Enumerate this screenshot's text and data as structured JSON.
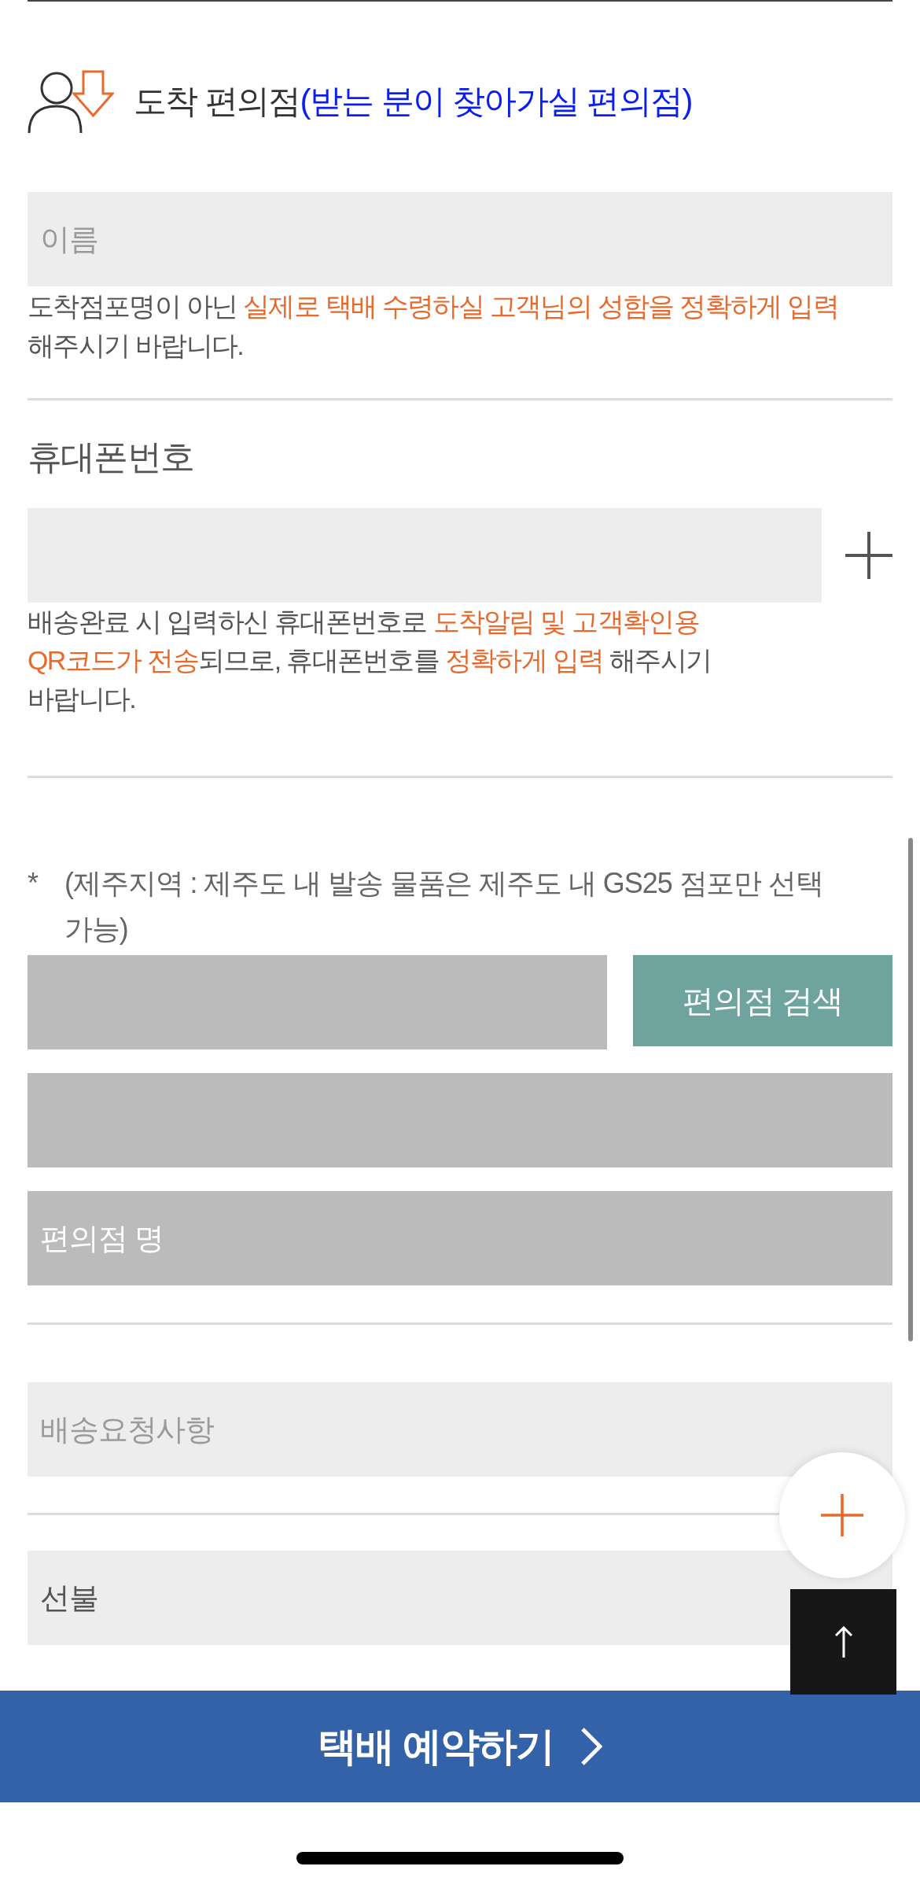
{
  "header": {
    "title": "도착 편의점",
    "subtitle": "(받는 분이 찾아가실 편의점)"
  },
  "recipient": {
    "name_field": {
      "placeholder": "이름",
      "disabled": false
    },
    "note": [
      {
        "text": "도착점포명이 아닌 ",
        "highlight": false
      },
      {
        "text": "실제로 택배 수령하실 고객님의 성함을 정확하게 입력",
        "highlight": true
      },
      {
        "text": " 해주시기 바랍니다.",
        "highlight": false
      }
    ]
  },
  "phone": {
    "label": "휴대폰번호",
    "field": {
      "disabled": false
    },
    "note": [
      {
        "text": "배송완료 시 입력하신 휴대폰번호로 ",
        "highlight": false
      },
      {
        "text": "도착알림 및 고객확인용 QR코드가 전송",
        "highlight": true
      },
      {
        "text": "되므로, 휴대폰번호를 ",
        "highlight": false
      },
      {
        "text": "정확하게 입력",
        "highlight": true
      },
      {
        "text": " 해주시기 바랍니다.",
        "highlight": false
      }
    ]
  },
  "store": {
    "notice_mark": "*",
    "notice": "(제주지역 : 제주도 내 발송 물품은 제주도 내 GS25 점포만 선택 가능)",
    "search_field": {
      "disabled": true
    },
    "search_button": "편의점 검색",
    "address_field": {
      "disabled": true
    },
    "name_field": {
      "placeholder": "편의점 명",
      "disabled": true
    }
  },
  "request_field": {
    "placeholder": "배송요청사항",
    "disabled": false
  },
  "payment_field": {
    "value": "선불",
    "disabled": false
  },
  "submit_button": "택배 예약하기"
}
